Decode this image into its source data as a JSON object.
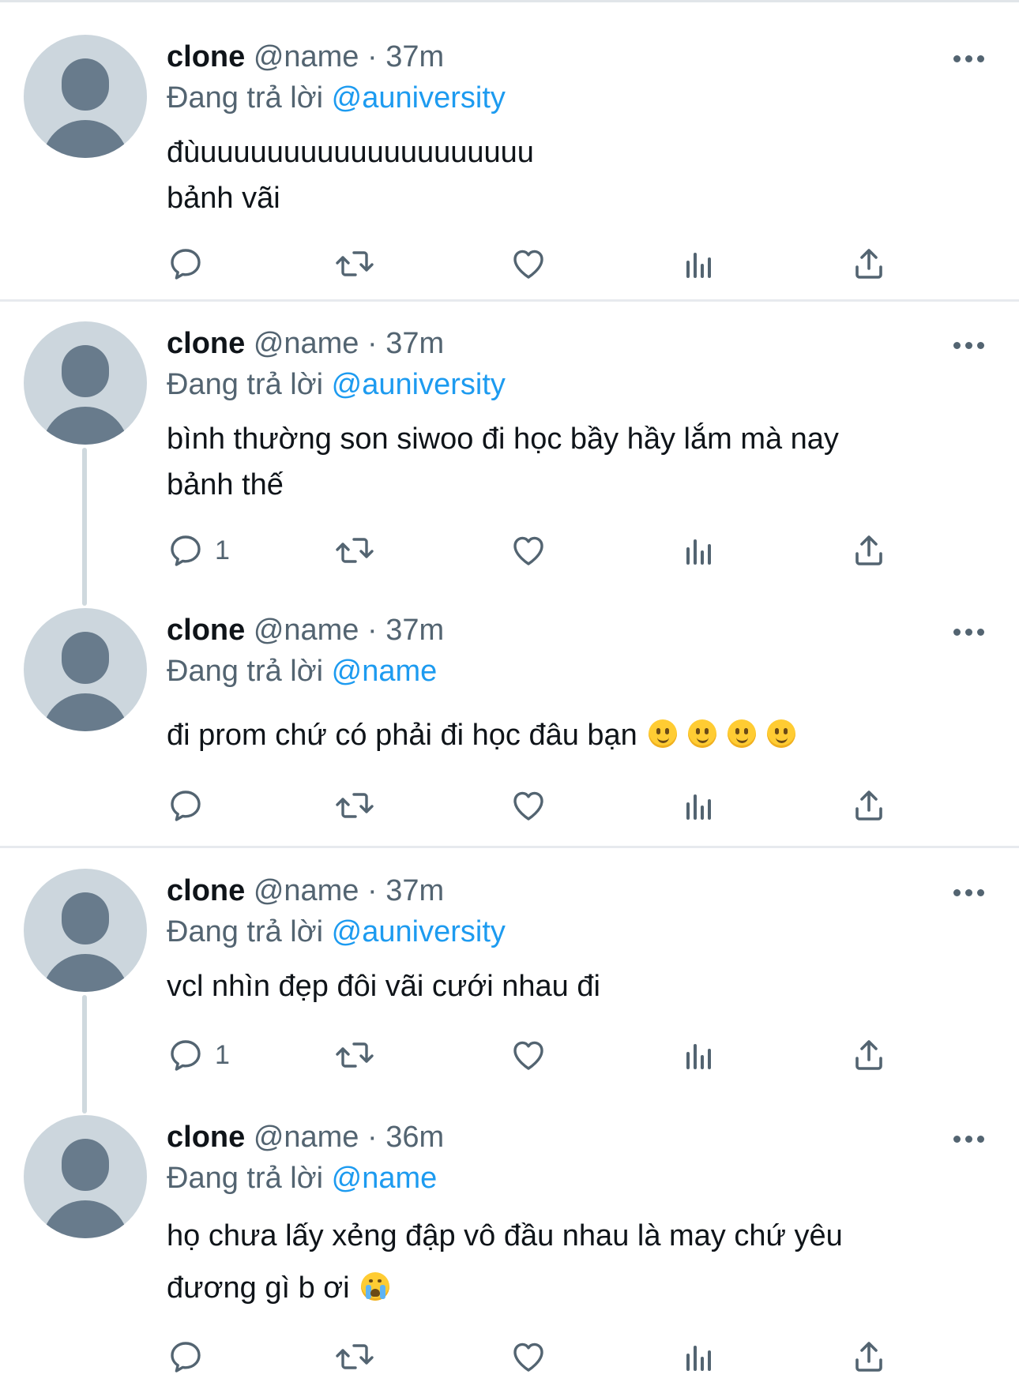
{
  "tweets": [
    {
      "name": "clone",
      "handle": "@name",
      "dot": "·",
      "time": "37m",
      "replying_prefix": "Đang trả lời",
      "replying_to": "@auniversity",
      "text_lines": [
        "đùuuuuuuuuuuuuuuuuuuuu",
        "bảnh vãi"
      ],
      "reply_count": ""
    },
    {
      "name": "clone",
      "handle": "@name",
      "dot": "·",
      "time": "37m",
      "replying_prefix": "Đang trả lời",
      "replying_to": "@auniversity",
      "text_lines": [
        "bình thường son siwoo đi học bầy hầy lắm mà nay",
        "bảnh thế"
      ],
      "reply_count": "1"
    },
    {
      "name": "clone",
      "handle": "@name",
      "dot": "·",
      "time": "37m",
      "replying_prefix": "Đang trả lời",
      "replying_to": "@name",
      "text_lines": [
        "đi prom chứ có phải đi học đâu bạn"
      ],
      "emojis": [
        "slightly-smiling-face",
        "slightly-smiling-face",
        "slightly-smiling-face",
        "slightly-smiling-face"
      ],
      "reply_count": ""
    },
    {
      "name": "clone",
      "handle": "@name",
      "dot": "·",
      "time": "37m",
      "replying_prefix": "Đang trả lời",
      "replying_to": "@auniversity",
      "text_lines": [
        "vcl nhìn đẹp đôi vãi cưới nhau đi"
      ],
      "reply_count": "1"
    },
    {
      "name": "clone",
      "handle": "@name",
      "dot": "·",
      "time": "36m",
      "replying_prefix": "Đang trả lời",
      "replying_to": "@name",
      "text_lines": [
        "họ chưa lấy xẻng đập vô đầu nhau là may chứ yêu",
        "đương gì b ơi"
      ],
      "emojis": [
        "loudly-crying-face"
      ],
      "reply_count": ""
    }
  ],
  "icons": {
    "reply": "reply-icon",
    "retweet": "retweet-icon",
    "like": "heart-icon",
    "views": "analytics-icon",
    "share": "share-icon",
    "more": "more-icon"
  },
  "colors": {
    "text": "#0f1419",
    "secondary": "#536471",
    "mention": "#1d9bf0",
    "avatar_bg": "#ccd6dd",
    "avatar_fg": "#687b8c",
    "divider": "#e7eaee"
  }
}
